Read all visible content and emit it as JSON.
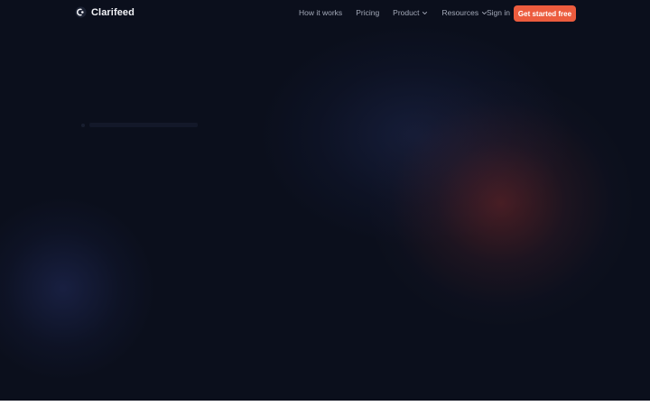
{
  "brand": {
    "name": "Clarifeed",
    "icon": "clarifeed-logo-icon"
  },
  "nav": {
    "links": [
      {
        "label": "How it works"
      },
      {
        "label": "Pricing"
      },
      {
        "label": "Product",
        "has_dropdown": true
      },
      {
        "label": "Resources",
        "has_dropdown": true
      }
    ],
    "sign_in": "Sign in",
    "cta": "Get started free"
  },
  "colors": {
    "background": "#0b0f1c",
    "accent": "#ec5c3e",
    "nav_text": "#a3a9b8",
    "brand_text": "#f2f3f7"
  }
}
